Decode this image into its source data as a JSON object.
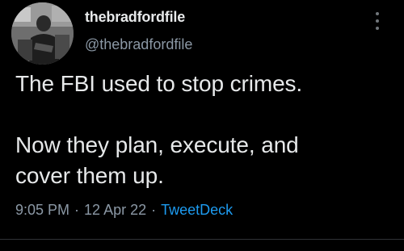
{
  "tweet": {
    "display_name": "thebradfordfile",
    "handle": "@thebradfordfile",
    "text": "The FBI used to stop crimes.\n\nNow they plan, execute, and\ncover them up.",
    "time": "9:05 PM",
    "separator": "·",
    "date": "12 Apr 22",
    "source": "TweetDeck"
  },
  "icons": {
    "avatar": "profile-photo",
    "more": "vertical-ellipsis-icon"
  },
  "colors": {
    "background": "#000000",
    "text_primary": "#e7e9ea",
    "text_secondary": "#8b98a5",
    "link": "#1d9bf0"
  }
}
